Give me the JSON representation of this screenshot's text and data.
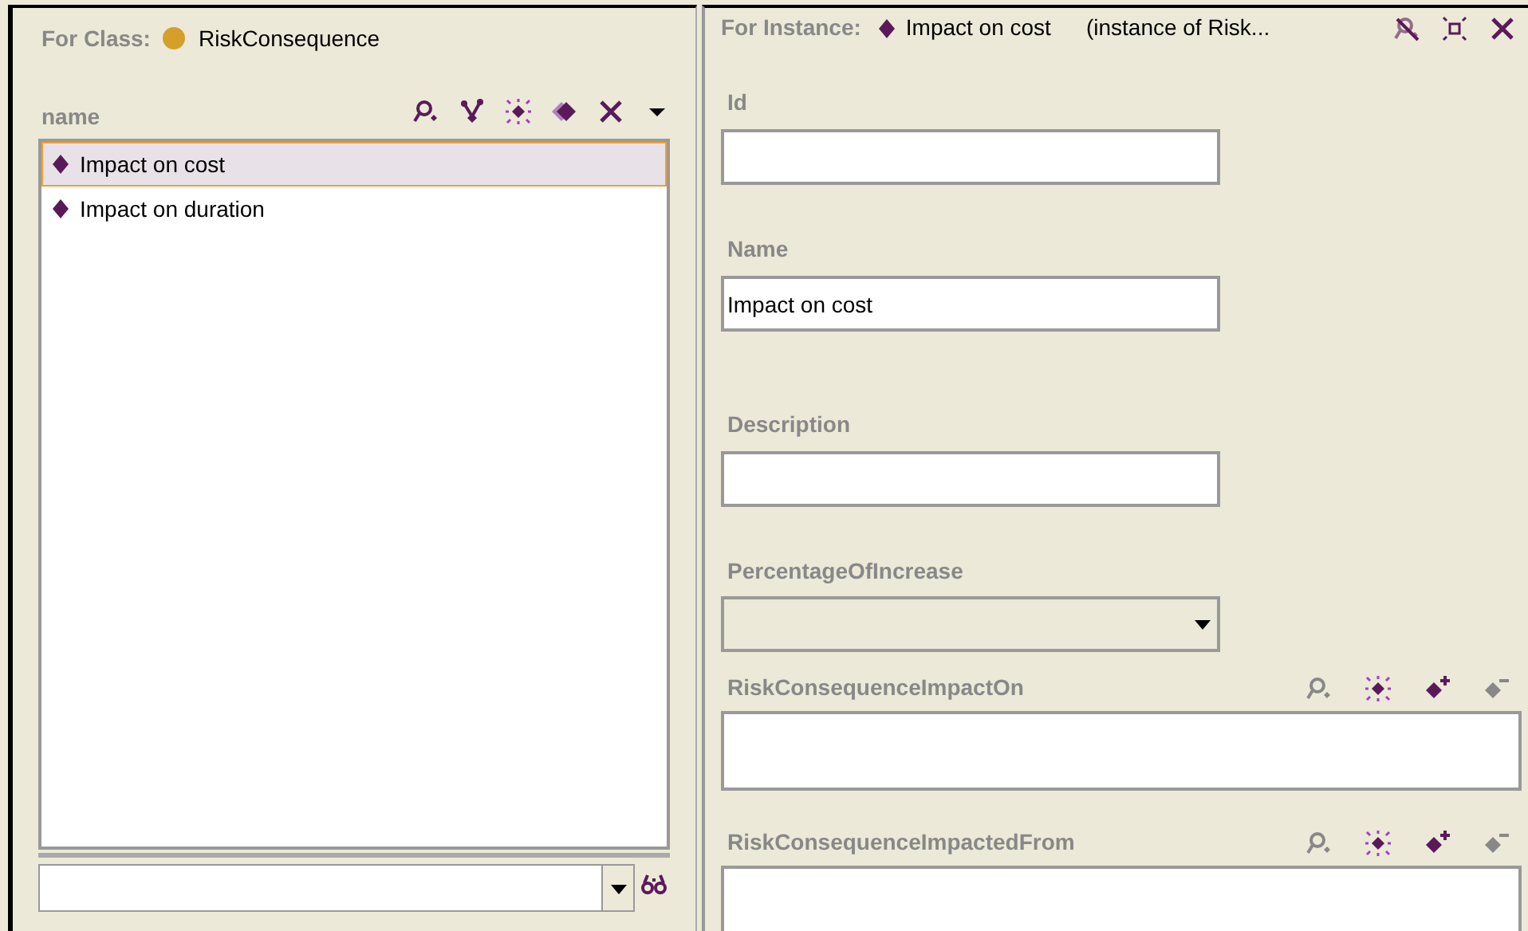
{
  "class_panel": {
    "label": "For Class:",
    "class_name": "RiskConsequence",
    "column_header": "name",
    "instances": [
      {
        "name": "Impact on cost",
        "selected": true
      },
      {
        "name": "Impact on duration",
        "selected": false
      }
    ]
  },
  "instance_panel": {
    "label": "For Instance:",
    "instance_name": "Impact on cost",
    "instance_of": "(instance of Risk...",
    "fields": [
      {
        "kind": "text",
        "label": "Id"
      },
      {
        "kind": "text",
        "label": "Name",
        "value": "Impact on cost"
      },
      {
        "kind": "text",
        "label": "Description"
      },
      {
        "kind": "select",
        "label": "PercentageOfIncrease"
      },
      {
        "kind": "list",
        "label": "RiskConsequenceImpactOn"
      },
      {
        "kind": "list",
        "label": "RiskConsequenceImpactedFrom"
      }
    ]
  }
}
